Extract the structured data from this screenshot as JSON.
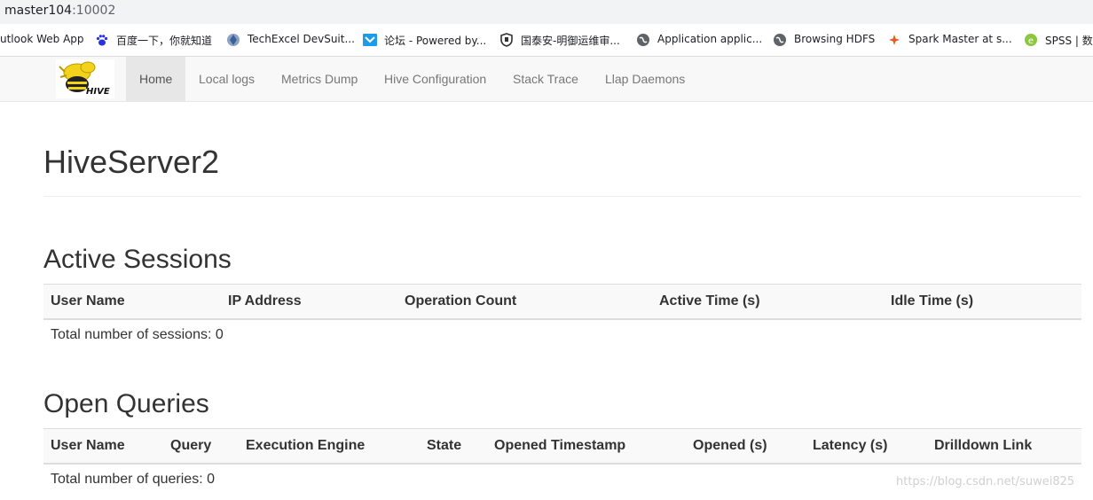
{
  "address_bar": {
    "host": "master104",
    "port": ":10002"
  },
  "bookmarks": [
    {
      "label": "utlook Web App",
      "icon": "none"
    },
    {
      "label": "百度一下，你就知道",
      "icon": "baidu-paw-icon"
    },
    {
      "label": "TechExcel DevSuit...",
      "icon": "techexcel-icon"
    },
    {
      "label": "论坛 - Powered by...",
      "icon": "forum-icon"
    },
    {
      "label": "国泰安-明御运维审...",
      "icon": "shield-icon"
    },
    {
      "label": "Application applic...",
      "icon": "globe-icon"
    },
    {
      "label": "Browsing HDFS",
      "icon": "globe-icon"
    },
    {
      "label": "Spark Master at s...",
      "icon": "spark-icon"
    },
    {
      "label": "SPSS | 数据",
      "icon": "spss-icon"
    }
  ],
  "navbar": {
    "logo_text": "HIVE",
    "tabs": [
      {
        "label": "Home",
        "active": true
      },
      {
        "label": "Local logs"
      },
      {
        "label": "Metrics Dump"
      },
      {
        "label": "Hive Configuration"
      },
      {
        "label": "Stack Trace"
      },
      {
        "label": "Llap Daemons"
      }
    ]
  },
  "page": {
    "title": "HiveServer2"
  },
  "active_sessions": {
    "heading": "Active Sessions",
    "columns": [
      "User Name",
      "IP Address",
      "Operation Count",
      "Active Time (s)",
      "Idle Time (s)"
    ],
    "total_text": "Total number of sessions: 0"
  },
  "open_queries": {
    "heading": "Open Queries",
    "columns": [
      "User Name",
      "Query",
      "Execution Engine",
      "State",
      "Opened Timestamp",
      "Opened (s)",
      "Latency (s)",
      "Drilldown Link"
    ],
    "total_text": "Total number of queries: 0"
  },
  "watermark": "https://blog.csdn.net/suwei825",
  "colors": {
    "navbar_bg": "#f8f8f8",
    "active_tab_bg": "#e7e7e7",
    "logo_yellow": "#f2d21b"
  }
}
